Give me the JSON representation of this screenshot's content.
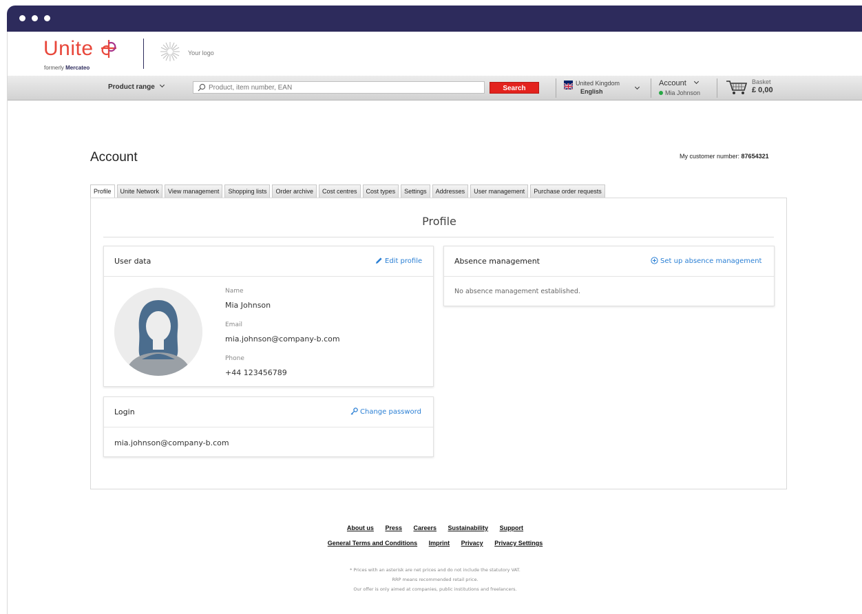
{
  "brand": {
    "name": "Unite",
    "formerly_prefix": "formerly",
    "formerly_name": "Mercateo",
    "your_logo": "Your logo"
  },
  "toolbar": {
    "product_range": "Product range",
    "search_placeholder": "Product, item number, EAN",
    "search_button": "Search",
    "country": "United Kingdom",
    "language": "English",
    "account_label": "Account",
    "account_user": "Mia Johnson",
    "basket_label": "Basket",
    "basket_total": "£ 0,00"
  },
  "account": {
    "title": "Account",
    "customer_number_label": "My customer number:",
    "customer_number": "87654321"
  },
  "tabs": [
    {
      "label": "Profile",
      "active": true
    },
    {
      "label": "Unite Network"
    },
    {
      "label": "View management"
    },
    {
      "label": "Shopping lists"
    },
    {
      "label": "Order archive"
    },
    {
      "label": "Cost centres"
    },
    {
      "label": "Cost types"
    },
    {
      "label": "Settings"
    },
    {
      "label": "Addresses"
    },
    {
      "label": "User management"
    },
    {
      "label": "Purchase order requests"
    }
  ],
  "profile": {
    "heading": "Profile",
    "user_data": {
      "title": "User data",
      "edit_link": "Edit profile",
      "name_label": "Name",
      "name": "Mia Johnson",
      "email_label": "Email",
      "email": "mia.johnson@company-b.com",
      "phone_label": "Phone",
      "phone": "+44 123456789"
    },
    "login": {
      "title": "Login",
      "change_link": "Change password",
      "value": "mia.johnson@company-b.com"
    },
    "absence": {
      "title": "Absence management",
      "setup_link": "Set up absence management",
      "empty_text": "No absence management established."
    }
  },
  "footer": {
    "links_row1": [
      "About us",
      "Press",
      "Careers",
      "Sustainability",
      "Support"
    ],
    "links_row2": [
      "General Terms and Conditions",
      "Imprint",
      "Privacy",
      "Privacy Settings"
    ],
    "notes": [
      "* Prices with an asterisk are net prices and do not include the statutory VAT.",
      "RRP means recommended retail price.",
      "Our offer is only aimed at companies, public institutions and freelancers."
    ]
  },
  "colors": {
    "chrome": "#2d2b5c",
    "brand_red": "#e8473b",
    "search_button": "#e3231e",
    "link_blue": "#2a7fd4",
    "status_online": "#28a745"
  }
}
